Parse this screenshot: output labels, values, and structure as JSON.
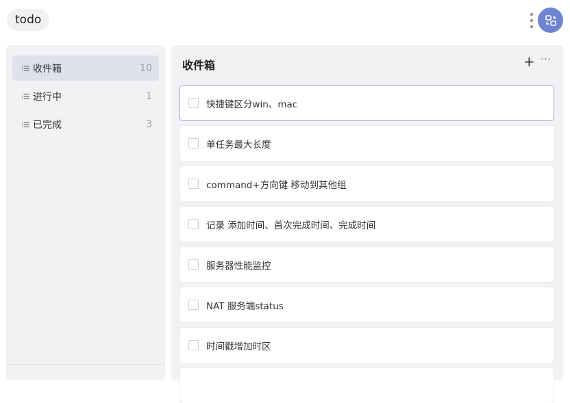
{
  "app": {
    "title": "todo"
  },
  "sidebar": {
    "items": [
      {
        "label": "收件箱",
        "count": "10"
      },
      {
        "label": "进行中",
        "count": "1"
      },
      {
        "label": "已完成",
        "count": "3"
      }
    ]
  },
  "main": {
    "title": "收件箱",
    "add_label": "+",
    "more_label": "···",
    "tasks": [
      "快捷键区分win、mac",
      "单任务最大长度",
      "command+方向键 移动到其他组",
      "记录 添加时间、首次完成时间、完成时间",
      "服务器性能监控",
      "NAT 服务端status",
      "时间戳增加时区"
    ]
  },
  "colors": {
    "accent": "#6f85d2",
    "sidebar_active": "#dfe2ec",
    "panel_bg": "#f2f2f4"
  },
  "icons": {
    "avatar": "swap-icon",
    "list": "list-icon",
    "menu": "more-vertical-icon"
  }
}
